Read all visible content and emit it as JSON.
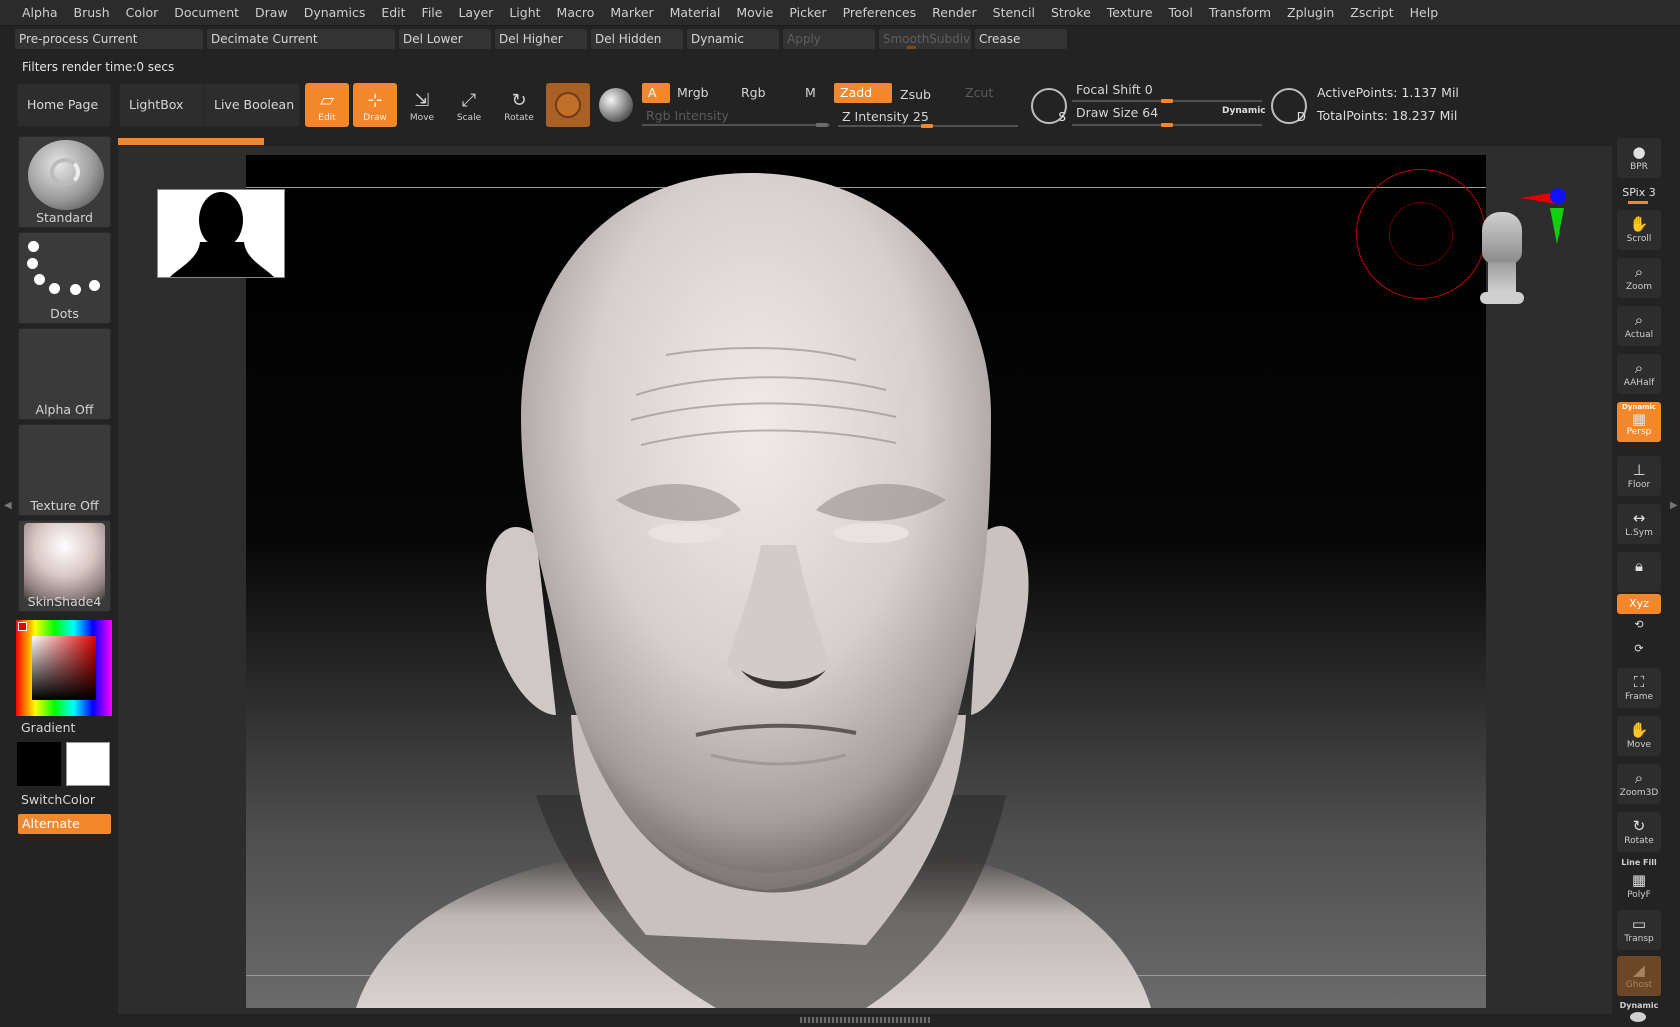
{
  "menu": [
    "Alpha",
    "Brush",
    "Color",
    "Document",
    "Draw",
    "Dynamics",
    "Edit",
    "File",
    "Layer",
    "Light",
    "Macro",
    "Marker",
    "Material",
    "Movie",
    "Picker",
    "Preferences",
    "Render",
    "Stencil",
    "Stroke",
    "Texture",
    "Tool",
    "Transform",
    "Zplugin",
    "Zscript",
    "Help"
  ],
  "commands": {
    "preprocess": "Pre-process Current",
    "decimate": "Decimate Current",
    "del_lower": "Del Lower",
    "del_higher": "Del Higher",
    "del_hidden": "Del Hidden",
    "dynamic": "Dynamic",
    "apply": "Apply",
    "smoothsubdiv": "SmoothSubdiv",
    "crease": "Crease"
  },
  "status": {
    "filters": "Filters render time:0 secs"
  },
  "shelf": {
    "home": "Home Page",
    "lightbox": "LightBox",
    "live_boolean": "Live Boolean",
    "edit": "Edit",
    "draw": "Draw",
    "move": "Move",
    "scale": "Scale",
    "rotate": "Rotate",
    "a": "A",
    "mrgb": "Mrgb",
    "rgb": "Rgb",
    "m": "M",
    "rgb_intensity": "Rgb Intensity",
    "zadd": "Zadd",
    "zsub": "Zsub",
    "zcut": "Zcut",
    "z_intensity": "Z Intensity 25",
    "focal_shift": "Focal Shift 0",
    "draw_size": "Draw Size 64",
    "dynamic": "Dynamic",
    "s": "S",
    "d": "D",
    "active_points": "ActivePoints: 1.137 Mil",
    "total_points": "TotalPoints: 18.237 Mil"
  },
  "left_tray": {
    "brush": "Standard",
    "stroke": "Dots",
    "alpha": "Alpha Off",
    "texture": "Texture Off",
    "material": "SkinShade4",
    "gradient": "Gradient",
    "switch_color": "SwitchColor",
    "alternate": "Alternate"
  },
  "right_shelf": {
    "bpr": "BPR",
    "spix": "SPix 3",
    "scroll": "Scroll",
    "zoom": "Zoom",
    "actual": "Actual",
    "aahalf": "AAHalf",
    "persp_dynamic": "Dynamic",
    "persp": "Persp",
    "floor": "Floor",
    "lsym": "L.Sym",
    "xyz": "Xyz",
    "frame": "Frame",
    "move": "Move",
    "zoom3d": "Zoom3D",
    "rotate": "Rotate",
    "line_fill": "Line Fill",
    "polyf": "PolyF",
    "transp": "Transp",
    "ghost": "Ghost",
    "bottom_dynamic": "Dynamic"
  },
  "colors": {
    "accent": "#f2872c",
    "background": "#232323",
    "panel": "#2d2d2d"
  }
}
